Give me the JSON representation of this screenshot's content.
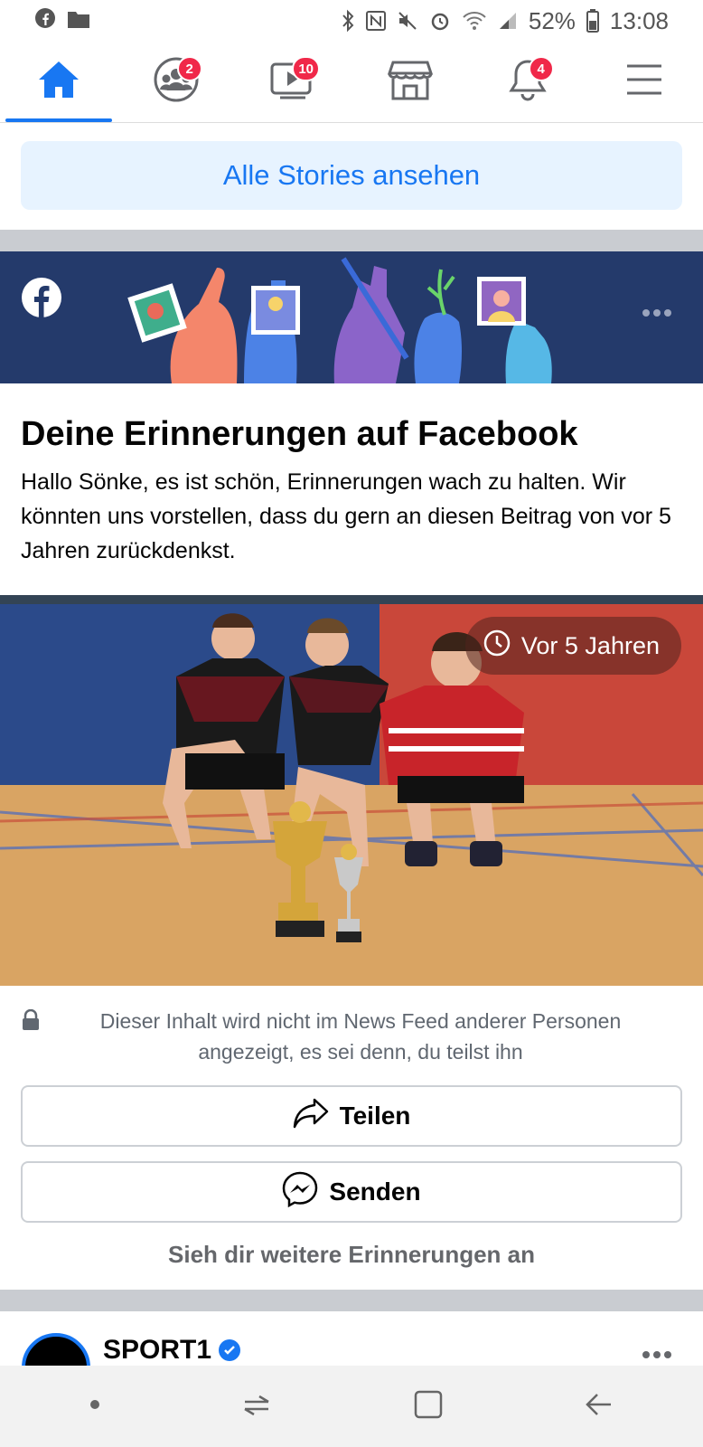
{
  "status_bar": {
    "battery": "52%",
    "time": "13:08"
  },
  "nav": {
    "tabs": [
      {
        "name": "home",
        "badge": ""
      },
      {
        "name": "groups",
        "badge": "2"
      },
      {
        "name": "watch",
        "badge": "10"
      },
      {
        "name": "marketplace",
        "badge": ""
      },
      {
        "name": "notifications",
        "badge": "4"
      },
      {
        "name": "menu",
        "badge": ""
      }
    ],
    "active_color": "#1877f2"
  },
  "stories": {
    "button_label": "Alle Stories ansehen"
  },
  "memories": {
    "title": "Deine Erinnerungen auf Facebook",
    "body": "Hallo Sönke, es ist schön, Erinnerungen wach zu halten. Wir könnten uns vorstellen, dass du gern an diesen Beitrag von vor 5 Jahren zurückdenkst.",
    "time_pill": "Vor 5 Jahren",
    "privacy_note": "Dieser Inhalt wird nicht im News Feed anderer Personen angezeigt, es sei denn, du teilst ihn",
    "share_label": "Teilen",
    "send_label": "Senden",
    "more_label": "Sieh dir weitere Erinnerungen an"
  },
  "next_post": {
    "page_name": "SPORT1"
  },
  "colors": {
    "brand": "#1877f2",
    "banner": "#243a6b",
    "badge": "#f02849"
  }
}
